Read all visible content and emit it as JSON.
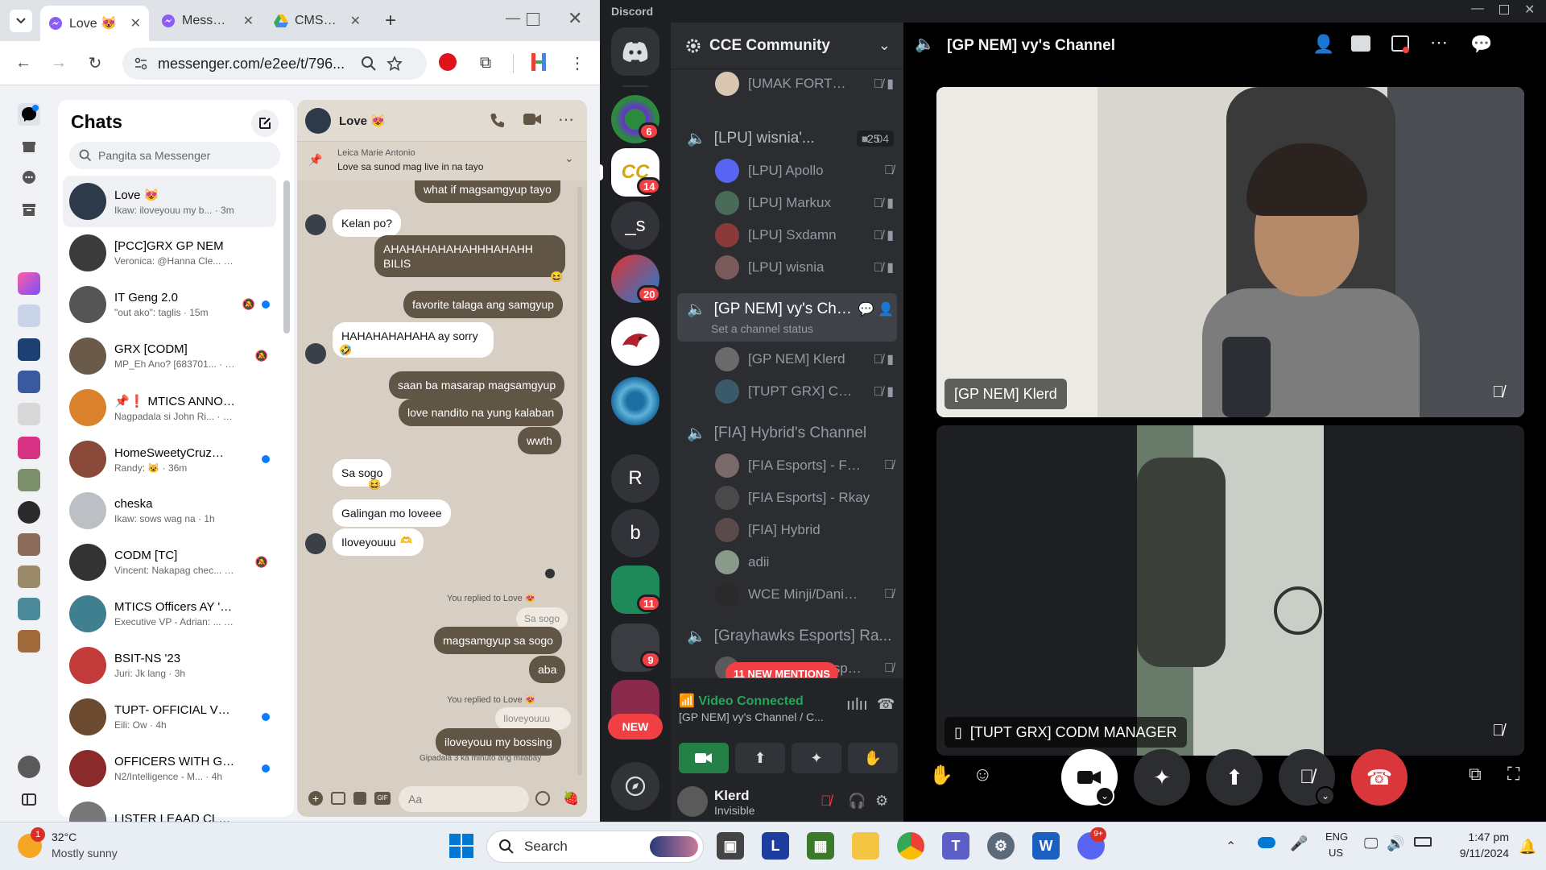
{
  "chrome": {
    "tabs": [
      {
        "label": "Love 😻",
        "active": true
      },
      {
        "label": "Messenger",
        "active": false
      },
      {
        "label": "CMS Ac",
        "active": false
      }
    ],
    "new_tab": "+",
    "url": "messenger.com/e2ee/t/796..."
  },
  "messenger": {
    "title": "Chats",
    "search_placeholder": "Pangita sa Messenger",
    "chats": [
      {
        "name": "Love 😻",
        "preview": "Ikaw: iloveyouu my b... · 3m",
        "selected": true,
        "color": "#2d3a4a",
        "unread": false,
        "muted": false
      },
      {
        "name": "[PCC]GRX GP NEM",
        "preview": "Veronica: @Hanna Cle... · 4m",
        "selected": false,
        "color": "#3b3b3b",
        "unread": false,
        "muted": false
      },
      {
        "name": "IT Geng 2.0",
        "preview": "\"out ako\": taglis · 15m",
        "selected": false,
        "color": "#555",
        "unread": true,
        "muted": true
      },
      {
        "name": "GRX [CODM]",
        "preview": "MP_Eh Ano? [683701... · 17m",
        "selected": false,
        "color": "#6a5a4a",
        "unread": false,
        "muted": true
      },
      {
        "name": "📌❗ MTICS ANNOU...",
        "preview": "Nagpadala si John Ri... · 35m",
        "selected": false,
        "color": "#d9822b",
        "unread": false,
        "muted": false
      },
      {
        "name": "HomeSweetyCruz❤️...",
        "preview": "Randy: 😺 · 36m",
        "selected": false,
        "color": "#8a4a3a",
        "unread": true,
        "muted": false
      },
      {
        "name": "cheska",
        "preview": "Ikaw: sows wag na · 1h",
        "selected": false,
        "color": "#bcc0c4",
        "unread": false,
        "muted": false
      },
      {
        "name": "CODM [TC]",
        "preview": "Vincent: Nakapag chec... · 2h",
        "selected": false,
        "color": "#333",
        "unread": false,
        "muted": true
      },
      {
        "name": "MTICS Officers AY '24...",
        "preview": "Executive VP - Adrian: ... · 2h",
        "selected": false,
        "color": "#3f7f8f",
        "unread": false,
        "muted": false
      },
      {
        "name": "BSIT-NS '23",
        "preview": "Juri: Jk lang · 3h",
        "selected": false,
        "color": "#c23a3a",
        "unread": false,
        "muted": false
      },
      {
        "name": "TUPT- OFFICIAL VB P...",
        "preview": "Eili: Ow · 4h",
        "selected": false,
        "color": "#6b4a2f",
        "unread": true,
        "muted": false
      },
      {
        "name": "OFFICERS WITH GMA...",
        "preview": "N2/Intelligence - M... · 4h",
        "selected": false,
        "color": "#8a2a2a",
        "unread": true,
        "muted": false
      },
      {
        "name": "LISTER LEAAD CLASS",
        "preview": "",
        "selected": false,
        "color": "#777",
        "unread": false,
        "muted": false
      }
    ],
    "conversation": {
      "title": "Love 😻",
      "pinned_author": "Leica Marie Antonio",
      "pinned_text": "Love sa sunod mag live in na tayo",
      "composer_placeholder": "Aa",
      "messages": {
        "m0": "what if magsamgyup tayo",
        "m1": "Kelan po?",
        "m2": "AHAHAHAHAHAHHHAHAHH BILIS",
        "m3": "favorite talaga ang samgyup",
        "m4": "HAHAHAHAHAHA ay sorry",
        "m5": "saan ba masarap magsamgyup",
        "m6": "love nandito na yung kalaban",
        "m7": "wwth",
        "m8": "Sa sogo",
        "m9": "Galingan mo loveee",
        "m10": "Iloveyouuu",
        "r1": "You replied to Love 😻",
        "q1": "Sa sogo",
        "m11": "magsamgyup sa sogo",
        "m12": "aba",
        "r2": "You replied to Love 😻",
        "q2": "Iloveyouuu",
        "m13": "iloveyouu my bossing",
        "sent": "Gipadala 3 ka minuto ang milabay"
      }
    }
  },
  "discord": {
    "app_name": "Discord",
    "server_name": "CCE Community",
    "guild_badges": [
      "6",
      "14",
      "20",
      "11",
      "9"
    ],
    "guild_letters": [
      "_s",
      "R",
      "b"
    ],
    "new_label": "NEW",
    "channels": {
      "top_member": "[UMAK FORTE...",
      "c1": "[LPU] wisnia'...",
      "c1_time": "04",
      "c1_count": "25",
      "c1_members": [
        "[LPU] Apollo",
        "[LPU] Markux",
        "[LPU] Sxdamn",
        "[LPU] wisnia"
      ],
      "c2": "[GP NEM] vy's Cha...",
      "c2_status": "Set a channel status",
      "c2_members": [
        "[GP NEM] Klerd",
        "[TUPT GRX] CO..."
      ],
      "c3": "[FIA] Hybrid's Channel",
      "c3_members": [
        "[FIA Esports] - FIA ...",
        "[FIA Esports] - Rkay",
        "[FIA] Hybrid",
        "adii",
        "WCE Minji/Dani - ..."
      ],
      "c4": "[Grayhawks Esports] Ra...",
      "c4_members": [
        "[Grayhawks Esport..."
      ],
      "mentions": "11 NEW MENTIONS"
    },
    "voice": {
      "status": "Video Connected",
      "channel": "[GP NEM] vy's Channel / C..."
    },
    "user": {
      "name": "Klerd",
      "status": "Invisible"
    },
    "stage": {
      "title": "[GP NEM] vy's Channel",
      "tile1": "[GP NEM] Klerd",
      "tile2": "[TUPT GRX] CODM MANAGER"
    }
  },
  "taskbar": {
    "weather_temp": "32°C",
    "weather_desc": "Mostly sunny",
    "weather_badge": "1",
    "search": "Search",
    "lang1": "ENG",
    "lang2": "US",
    "time": "1:47 pm",
    "date": "9/11/2024",
    "discord_badge": "9+"
  }
}
